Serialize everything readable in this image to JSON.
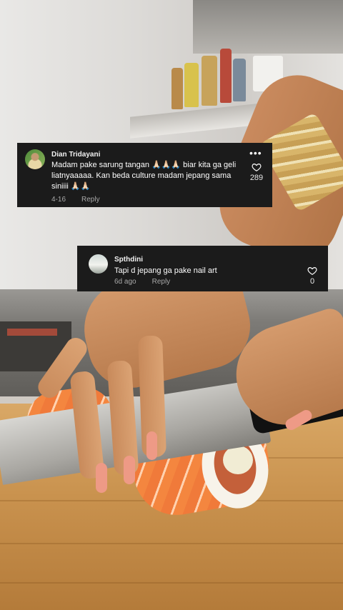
{
  "comments": [
    {
      "username": "Dian Tridayani",
      "text": "Madam pake sarung tangan 🙏🏻🙏🏻🙏🏻 biar kita ga geli liatnyaaaaa. Kan beda culture madam jepang sama siniiii 🙏🏻🙏🏻",
      "date": "4-16",
      "reply_label": "Reply",
      "likes": "289",
      "more_icon": "more-icon"
    },
    {
      "username": "Spthdini",
      "text": "Tapi d jepang ga pake nail art",
      "date": "6d ago",
      "reply_label": "Reply",
      "likes": "0"
    }
  ],
  "icons": {
    "like": "heart-outline-icon",
    "more": "ellipsis-icon"
  },
  "colors": {
    "overlay_bg": "#1b1b1b",
    "meta_text": "#a8a8a8",
    "text": "#ffffff"
  }
}
